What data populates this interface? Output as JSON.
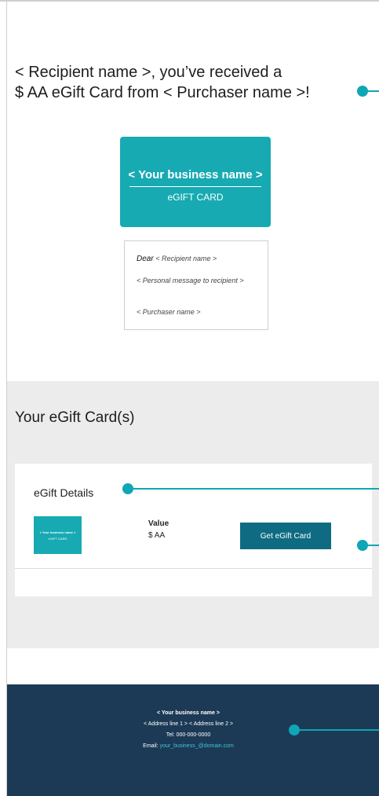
{
  "email": {
    "headline_line1": "< Recipient name >, you’ve received a",
    "headline_line2": "$ AA eGift Card from < Purchaser name >!",
    "card": {
      "business_name": "< Your business name >",
      "card_type": "eGIFT CARD"
    },
    "message": {
      "dear_word": "Dear",
      "recipient": "< Recipient name >",
      "personal_message": "< Personal message to recipient >",
      "purchaser": "< Purchaser name >"
    },
    "cards_section": {
      "title": "Your eGift Card(s)",
      "details_title": "eGift Details",
      "thumbnail_business": "< Your business name >",
      "thumbnail_type": "eGIFT CARD",
      "value_label": "Value",
      "value_amount": "$ AA",
      "button_label": "Get eGift Card"
    },
    "footer": {
      "business_name": "< Your business name >",
      "address": "< Address line 1 > < Address line 2 >",
      "tel": "Tel: 000-000-0000",
      "email_label": "Email: ",
      "email_link": "your_business_@domain.com"
    }
  },
  "colors": {
    "accent": "#0fa6b6",
    "card": "#17aab3",
    "button": "#0e6b82",
    "footer": "#1c3a55",
    "section_bg": "#ececec"
  }
}
